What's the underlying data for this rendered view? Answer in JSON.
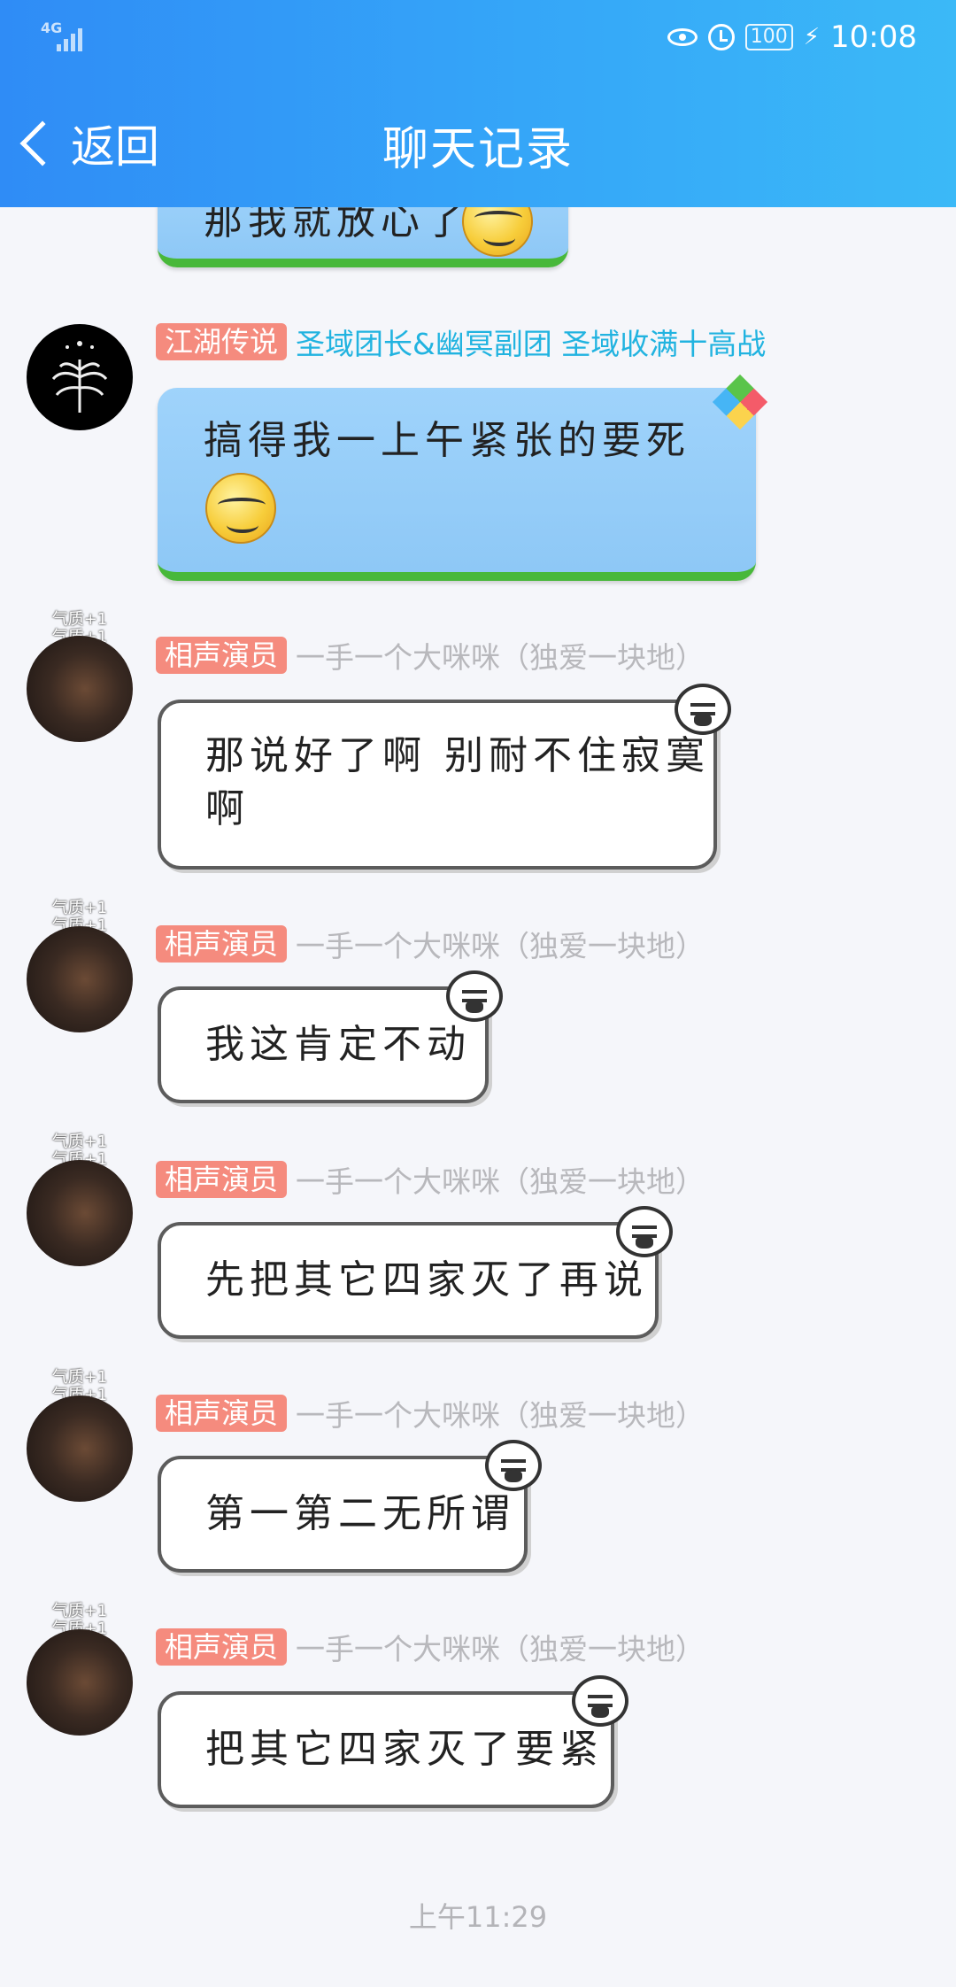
{
  "status_bar": {
    "network": "4G",
    "battery": "100",
    "time": "10:08"
  },
  "header": {
    "back_label": "返回",
    "title": "聊天记录"
  },
  "messages": [
    {
      "sender_tag": "",
      "sender_name": "",
      "text": "那我就放心了"
    },
    {
      "sender_tag": "江湖传说",
      "sender_name": "圣域团长&幽冥副团 圣域收满十高战",
      "text": "搞得我一上午紧张的要死"
    },
    {
      "badge": "气质+1",
      "sender_tag": "相声演员",
      "sender_name": "一手一个大咪咪（独爱一块地）",
      "text_line1": "那说好了啊 别耐不住寂寞",
      "text_line2": "啊"
    },
    {
      "badge": "气质+1",
      "sender_tag": "相声演员",
      "sender_name": "一手一个大咪咪（独爱一块地）",
      "text": "我这肯定不动"
    },
    {
      "badge": "气质+1",
      "sender_tag": "相声演员",
      "sender_name": "一手一个大咪咪（独爱一块地）",
      "text": "先把其它四家灭了再说"
    },
    {
      "badge": "气质+1",
      "sender_tag": "相声演员",
      "sender_name": "一手一个大咪咪（独爱一块地）",
      "text": "第一第二无所谓"
    },
    {
      "badge": "气质+1",
      "sender_tag": "相声演员",
      "sender_name": "一手一个大咪咪（独爱一块地）",
      "text": "把其它四家灭了要紧"
    }
  ],
  "timestamp": "上午11:29",
  "colors": {
    "header_start": "#2f8cf6",
    "header_end": "#3bb9f7",
    "tag_bg": "#f58b7e",
    "nick_blue": "#21b3e0",
    "nick_gray": "#b8b8bc"
  }
}
